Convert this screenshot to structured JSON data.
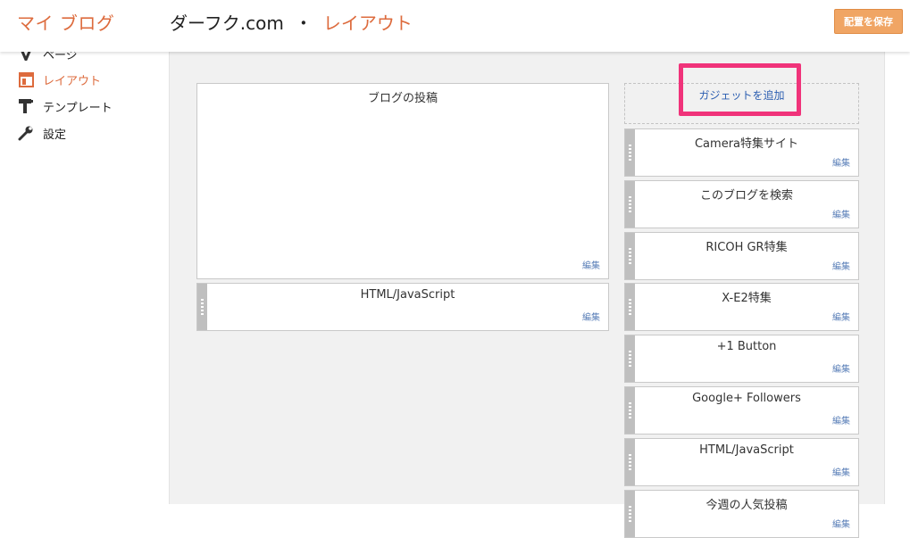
{
  "header": {
    "brand": "マイ ブログ",
    "site_name": "ダーフク.com",
    "separator": "・",
    "page_name": "レイアウト",
    "save_label": "配置を保存"
  },
  "sidebar": {
    "items": [
      {
        "label": "ページ",
        "icon": "page-icon"
      },
      {
        "label": "レイアウト",
        "icon": "layout-icon",
        "active": true
      },
      {
        "label": "テンプレート",
        "icon": "template-icon"
      },
      {
        "label": "設定",
        "icon": "wrench-icon"
      }
    ]
  },
  "layout": {
    "main_column": {
      "blog_posts": {
        "title": "ブログの投稿",
        "edit": "編集"
      },
      "gadgets": [
        {
          "title": "HTML/JavaScript",
          "edit": "編集"
        }
      ]
    },
    "side_column": {
      "add_gadget_label": "ガジェットを追加",
      "gadgets": [
        {
          "title": "Camera特集サイト",
          "edit": "編集"
        },
        {
          "title": "このブログを検索",
          "edit": "編集"
        },
        {
          "title": "RICOH GR特集",
          "edit": "編集"
        },
        {
          "title": "X-E2特集",
          "edit": "編集"
        },
        {
          "title": "+1 Button",
          "edit": "編集"
        },
        {
          "title": "Google+ Followers",
          "edit": "編集"
        },
        {
          "title": "HTML/JavaScript",
          "edit": "編集"
        },
        {
          "title": "今週の人気投稿",
          "edit": "編集"
        }
      ]
    }
  },
  "colors": {
    "brand": "#dd6b3d",
    "save_button": "#f0a564",
    "highlight": "#f0337a",
    "link": "#2a5db0"
  }
}
